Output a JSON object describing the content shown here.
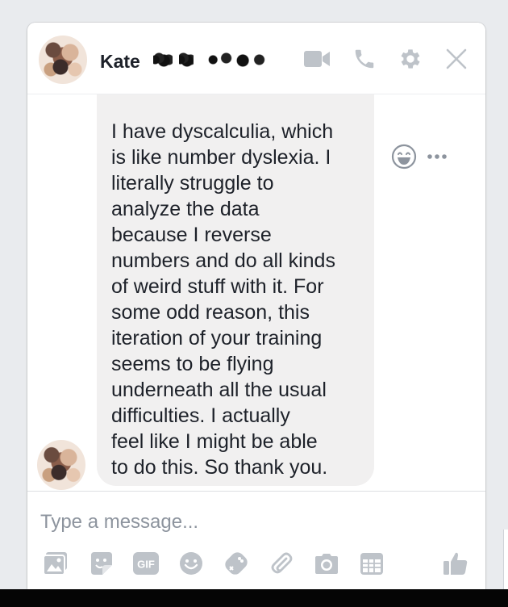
{
  "header": {
    "contact_name": "Kate",
    "icons": [
      "video-camera-icon",
      "phone-icon",
      "gear-icon",
      "close-icon"
    ]
  },
  "conversation": {
    "message_text": "I have dyscalculia,  which\nis like number dyslexia.  I\nliterally struggle to\nanalyze the data\nbecause I reverse\nnumbers and do all kinds\nof weird stuff with it. For\nsome odd reason, this\niteration of your training\nseems to be flying\nunderneath all the usual\ndifficulties.  I actually\nfeel like I might be able\nto do this.  So thank you."
  },
  "composer": {
    "placeholder": "Type a message...",
    "gif_label": "GIF",
    "tools": [
      "photo-icon",
      "sticker-icon",
      "gif-icon",
      "emoji-icon",
      "game-controller-icon",
      "attachment-icon",
      "camera-icon",
      "calendar-icon",
      "thumbs-up-icon"
    ]
  },
  "colors": {
    "icon_gray": "#bec3c9",
    "bubble_gray": "#f1f0f0",
    "text": "#1d2129",
    "placeholder": "#8d949e"
  }
}
